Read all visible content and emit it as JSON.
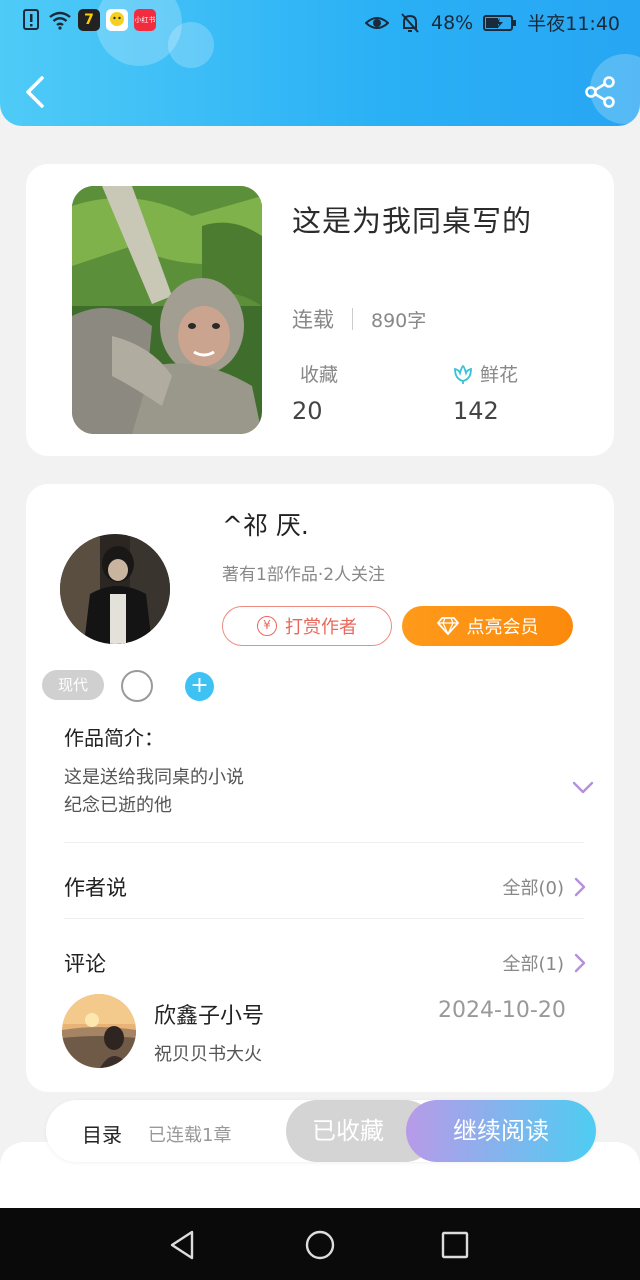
{
  "status_bar": {
    "battery": "48%",
    "time": "半夜11:40",
    "app_icons": [
      "warning-icon",
      "wifi-icon",
      "app-7-icon",
      "app-chat-icon",
      "xiaohongshu-icon"
    ],
    "xiaohongshu": "小红书"
  },
  "header": {
    "back_icon": "chevron-left-icon",
    "share_icon": "share-icon",
    "color_start": "#4fcbf7",
    "color_end": "#27a6f3"
  },
  "book": {
    "title": "这是为我同桌写的",
    "status": "连载",
    "word_count": "890字",
    "favorites_label": "收藏",
    "favorites_value": "20",
    "flowers_label": "鲜花",
    "flowers_value": "142"
  },
  "author": {
    "name": "^祁 厌.",
    "meta": "著有1部作品·2人关注",
    "tip_button": "打赏作者",
    "vip_button": "点亮会员",
    "tip_symbol": "¥"
  },
  "tags": {
    "genre": "现代",
    "add": "+"
  },
  "intro": {
    "heading": "作品简介：",
    "lines": [
      "这是送给我同桌的小说",
      "纪念已逝的他"
    ]
  },
  "author_says": {
    "label": "作者说",
    "link": "全部(0)"
  },
  "comments": {
    "label": "评论",
    "link": "全部(1)",
    "items": [
      {
        "name": "欣鑫子小号",
        "date": "2024-10-20",
        "text": "祝贝贝书大火"
      }
    ]
  },
  "bottom": {
    "toc_label": "目录",
    "toc_status": "已连载1章",
    "collected": "已收藏",
    "continue": "继续阅读"
  }
}
